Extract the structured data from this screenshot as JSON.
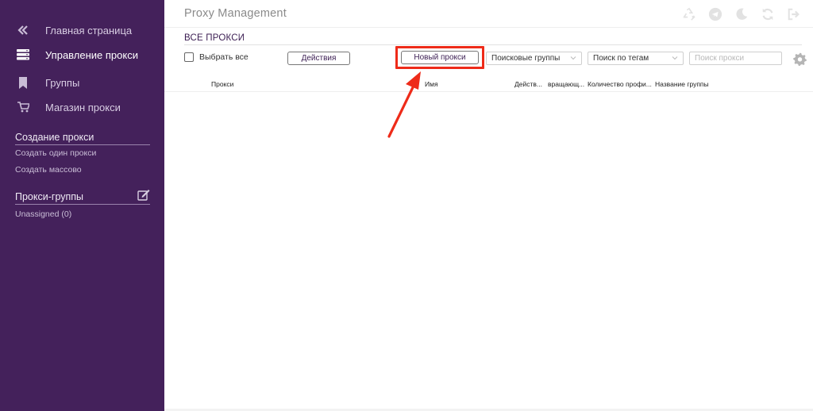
{
  "app": {
    "title": "Proxy Management"
  },
  "sidebar": {
    "nav": [
      {
        "label": "Главная страница",
        "icon": "double-chevron-left-icon"
      },
      {
        "label": "Управление прокси",
        "icon": "server-icon",
        "active": true
      },
      {
        "label": "Группы",
        "icon": "bookmark-icon"
      },
      {
        "label": "Магазин прокси",
        "icon": "cart-icon"
      }
    ],
    "create_section": {
      "heading": "Создание прокси",
      "links": [
        "Создать один прокси",
        "Создать массово"
      ]
    },
    "groups_section": {
      "heading": "Прокси-группы",
      "icon": "edit-icon",
      "items": [
        "Unassigned (0)"
      ]
    }
  },
  "header": {
    "icons": [
      "recycle-icon",
      "telegram-icon",
      "moon-icon",
      "refresh-icon",
      "logout-icon"
    ]
  },
  "main": {
    "section_title": "ВСЕ ПРОКСИ",
    "toolbar": {
      "select_all_label": "Выбрать все",
      "actions_label": "Действия",
      "new_proxy_label": "Новый прокси",
      "search_groups_label": "Поисковые группы",
      "search_tags_label": "Поиск по тегам",
      "search_placeholder": "Поиск прокси"
    },
    "table": {
      "columns": [
        "Прокси",
        "Имя",
        "Действ...",
        "вращающ...",
        "Количество профи...",
        "Название группы"
      ],
      "rows": []
    }
  },
  "colors": {
    "sidebar_bg": "#44215b",
    "accent": "#3b1d52",
    "highlight": "#ee2b19"
  }
}
